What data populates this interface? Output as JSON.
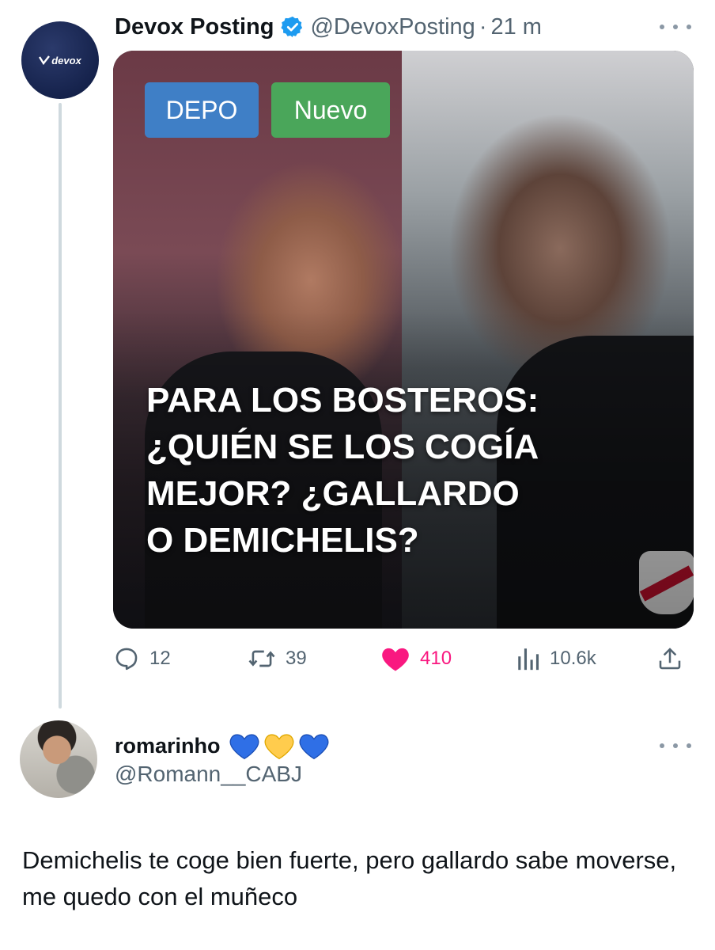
{
  "tweet": {
    "author": {
      "display_name": "Devox Posting",
      "handle": "@DevoxPosting",
      "avatar_text": "devox",
      "verified": true
    },
    "separator": "·",
    "time": "21 m",
    "media": {
      "badges": [
        "DEPO",
        "Nuevo"
      ],
      "headline_lines": [
        "PARA LOS BOSTEROS:",
        "¿QUIÉN SE LOS COGÍA",
        "MEJOR? ¿GALLARDO",
        "O DEMICHELIS?"
      ]
    },
    "actions": {
      "replies": "12",
      "retweets": "39",
      "likes": "410",
      "views": "10.6k"
    }
  },
  "reply": {
    "author": {
      "display_name": "romarinho",
      "handle": "@Romann__CABJ",
      "emoji_hearts": [
        "blue",
        "yellow",
        "blue"
      ]
    },
    "text": "Demichelis te coge bien fuerte, pero gallardo sabe moverse, me quedo con el muñeco"
  },
  "colors": {
    "like_active": "#f91880",
    "secondary_text": "#536471",
    "verified": "#1d9bf0",
    "badge_depo": "#3f7fc6",
    "badge_nuevo": "#4aa65a"
  }
}
